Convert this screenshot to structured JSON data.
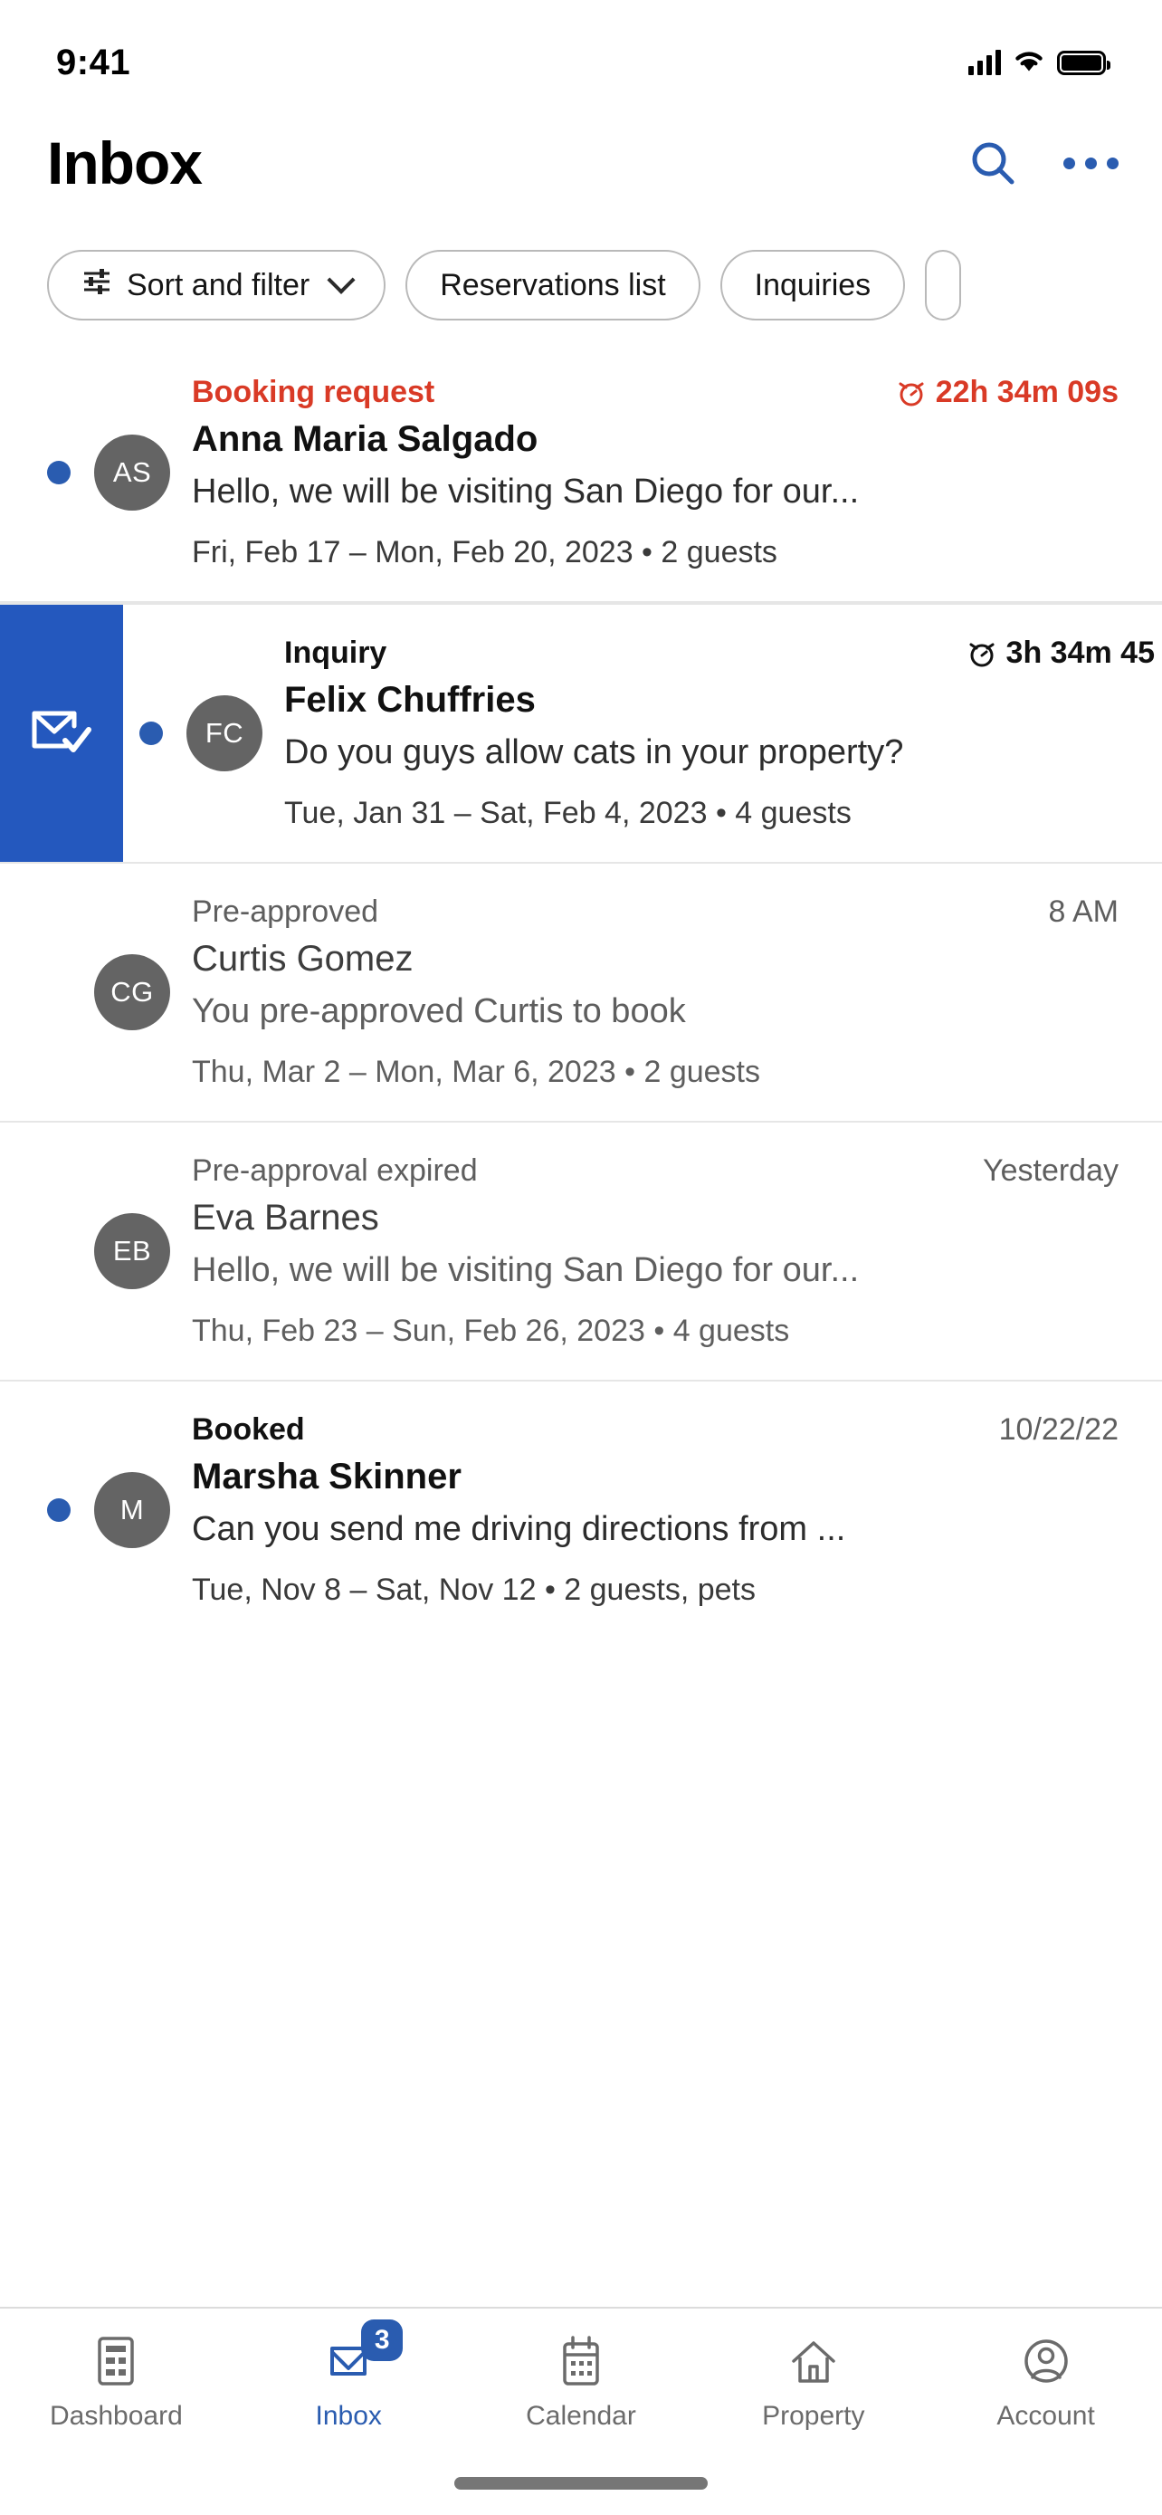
{
  "status_bar": {
    "time": "9:41",
    "cellular_icon": "signal-bars-icon",
    "wifi_icon": "wifi-icon",
    "battery_icon": "battery-full-icon"
  },
  "header": {
    "title": "Inbox",
    "search_icon": "search-icon",
    "more_icon": "more-options-icon"
  },
  "filters": {
    "chips": [
      {
        "label": "Sort and filter",
        "icon": "sliders-filter-icon",
        "has_chevron": true
      },
      {
        "label": "Reservations list",
        "icon": "",
        "has_chevron": false
      },
      {
        "label": "Inquiries",
        "icon": "",
        "has_chevron": false
      }
    ]
  },
  "accent_colors": {
    "blue": "#2A5CB0",
    "swipe_blue": "#2458BE",
    "urgent_red": "#D93A26",
    "avatar_gray": "#646464"
  },
  "messages": [
    {
      "status": "Booking request",
      "status_style": "urgent",
      "time": "22h 34m 09s",
      "time_style": "urgent",
      "timer_icon": "alarm-clock-icon",
      "initials": "AS",
      "name": "Anna Maria Salgado",
      "preview": "Hello, we will be visiting San Diego for our...",
      "dates": "Fri, Feb 17 – Mon, Feb 20, 2023  •  2 guests",
      "unread": true,
      "swiped": false
    },
    {
      "status": "Inquiry",
      "status_style": "bold",
      "time": "3h 34m 45",
      "time_style": "bold",
      "timer_icon": "alarm-clock-icon",
      "initials": "FC",
      "name": "Felix Chuffries",
      "preview": "Do you guys allow cats in your property?",
      "dates": "Tue, Jan 31 – Sat, Feb 4, 2023  •  4 guests",
      "unread": true,
      "swiped": true,
      "swipe_action_icon": "mark-as-read-envelope-icon"
    },
    {
      "status": "Pre-approved",
      "status_style": "normal",
      "time": "8 AM",
      "time_style": "normal",
      "timer_icon": "",
      "initials": "CG",
      "name": "Curtis Gomez",
      "preview": "You pre-approved Curtis to book",
      "dates": "Thu, Mar 2 – Mon, Mar 6, 2023  •  2 guests",
      "unread": false,
      "swiped": false
    },
    {
      "status": "Pre-approval expired",
      "status_style": "normal",
      "time": "Yesterday",
      "time_style": "normal",
      "timer_icon": "",
      "initials": "EB",
      "name": "Eva Barnes",
      "preview": "Hello, we will be visiting San Diego for our...",
      "dates": "Thu, Feb 23 – Sun, Feb 26, 2023  •  4 guests",
      "unread": false,
      "swiped": false
    },
    {
      "status": "Booked",
      "status_style": "bold",
      "time": "10/22/22",
      "time_style": "normal",
      "timer_icon": "",
      "initials": "M",
      "name": "Marsha Skinner",
      "preview": "Can you send me driving directions from ...",
      "dates": "Tue, Nov 8 – Sat, Nov 12  •  2 guests, pets",
      "unread": true,
      "swiped": false
    }
  ],
  "tabbar": {
    "tabs": [
      {
        "label": "Dashboard",
        "icon": "dashboard-icon",
        "active": false,
        "badge": ""
      },
      {
        "label": "Inbox",
        "icon": "inbox-envelope-icon",
        "active": true,
        "badge": "3"
      },
      {
        "label": "Calendar",
        "icon": "calendar-icon",
        "active": false,
        "badge": ""
      },
      {
        "label": "Property",
        "icon": "house-icon",
        "active": false,
        "badge": ""
      },
      {
        "label": "Account",
        "icon": "account-person-icon",
        "active": false,
        "badge": ""
      }
    ]
  }
}
